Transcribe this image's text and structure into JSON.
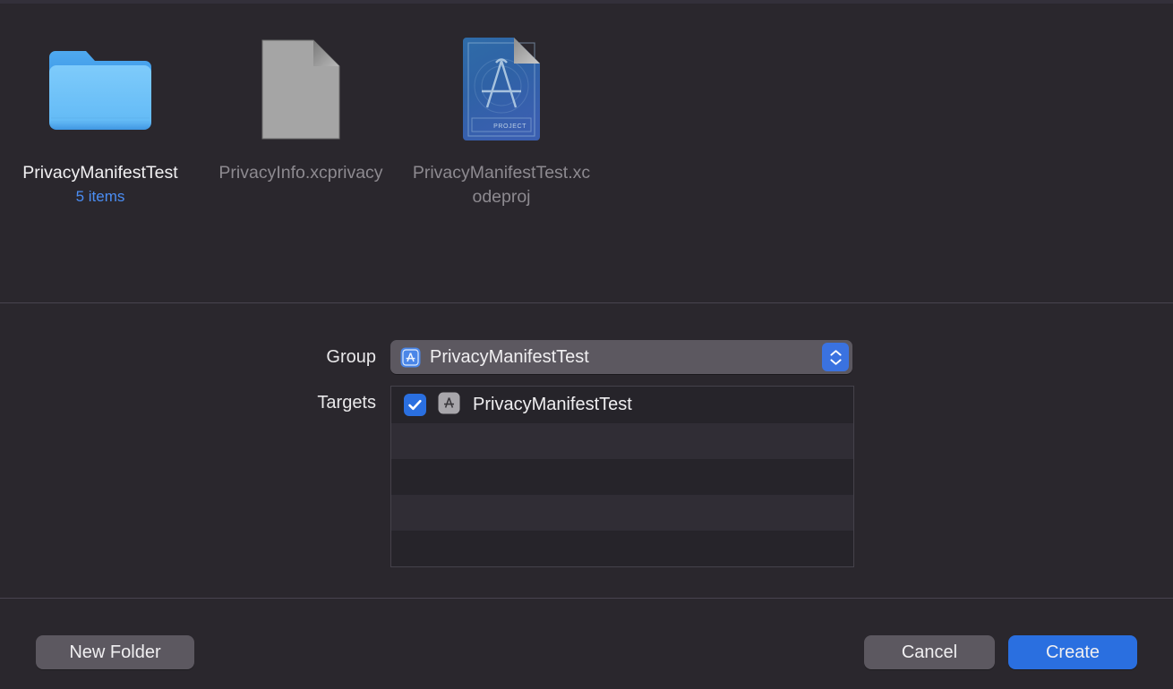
{
  "window": {
    "title": "Save Dialog",
    "background_color": "#2a272d"
  },
  "browser": {
    "files": [
      {
        "name": "PrivacyManifestTest",
        "subtitle": "5 items",
        "icon": "folder-icon",
        "selected": true
      },
      {
        "name": "PrivacyInfo.xcprivacy",
        "subtitle": "",
        "icon": "generic-document-icon",
        "selected": false
      },
      {
        "name": "PrivacyManifestTest.xcodeproj",
        "subtitle": "",
        "icon": "xcode-project-icon",
        "selected": false
      }
    ]
  },
  "options": {
    "group": {
      "label": "Group",
      "value": "PrivacyManifestTest",
      "icon": "xcode-app-icon",
      "stepper_icon": "up-down-chevron-icon"
    },
    "targets": {
      "label": "Targets",
      "rows": [
        {
          "name": "PrivacyManifestTest",
          "checked": true,
          "icon": "xcode-target-icon"
        },
        {
          "name": "",
          "checked": false,
          "icon": ""
        },
        {
          "name": "",
          "checked": false,
          "icon": ""
        },
        {
          "name": "",
          "checked": false,
          "icon": ""
        },
        {
          "name": "",
          "checked": false,
          "icon": ""
        }
      ]
    }
  },
  "actions": {
    "new_folder_label": "New Folder",
    "cancel_label": "Cancel",
    "create_label": "Create"
  },
  "colors": {
    "accent_blue": "#2a6fe0",
    "stepper_blue": "#3a72e0",
    "folder_blue": "#6ec0f7",
    "subtitle_blue": "#4b8ef4",
    "control_gray": "#5c5860",
    "text_primary": "#f0eff1",
    "text_dim": "#8d8a90",
    "separator": "#48444f"
  }
}
